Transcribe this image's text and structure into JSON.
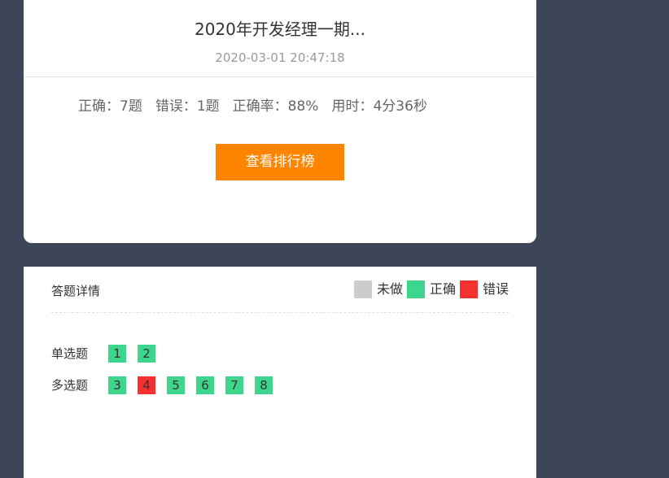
{
  "result": {
    "title": "2020年开发经理一期...",
    "time": "2020-03-01 20:47:18",
    "stats": [
      "正确：7题",
      "错误：1题",
      "正确率：88%",
      "用时：4分36秒"
    ],
    "rank_button_label": "查看排行榜"
  },
  "detail": {
    "title": "答题详情",
    "legend": [
      {
        "label": "未做",
        "color": "#cccccc"
      },
      {
        "label": "正确",
        "color": "#3dd68c"
      },
      {
        "label": "错误",
        "color": "#f43030"
      }
    ],
    "groups": [
      {
        "label": "单选题",
        "questions": [
          {
            "num": "1",
            "status": "correct"
          },
          {
            "num": "2",
            "status": "correct"
          }
        ]
      },
      {
        "label": "多选题",
        "questions": [
          {
            "num": "3",
            "status": "correct"
          },
          {
            "num": "4",
            "status": "wrong"
          },
          {
            "num": "5",
            "status": "correct"
          },
          {
            "num": "6",
            "status": "correct"
          },
          {
            "num": "7",
            "status": "correct"
          },
          {
            "num": "8",
            "status": "correct"
          }
        ]
      }
    ]
  },
  "colors": {
    "background": "#3c4658",
    "accent": "#ff8400",
    "correct": "#3dd68c",
    "wrong": "#f43030",
    "unanswered": "#cccccc"
  }
}
